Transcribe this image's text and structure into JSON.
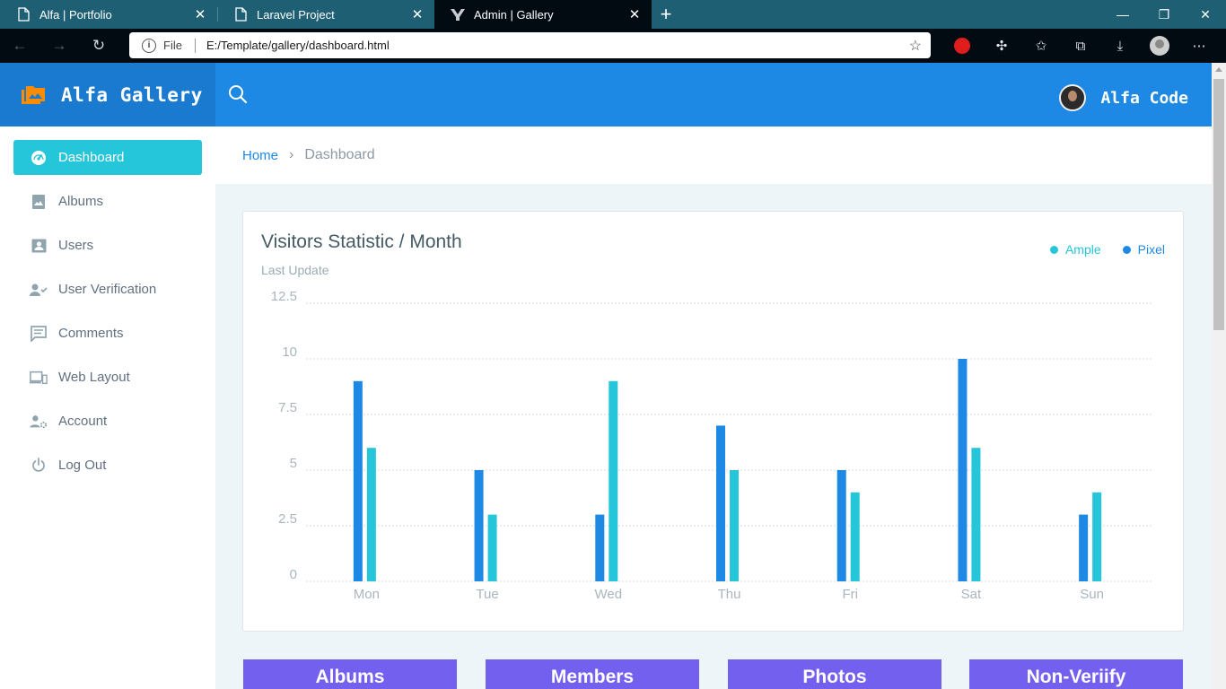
{
  "browser": {
    "tabs": [
      {
        "title": "Alfa | Portfolio",
        "active": false,
        "icon": "page-icon"
      },
      {
        "title": "Laravel Project",
        "active": false,
        "icon": "page-icon"
      },
      {
        "title": "Admin | Gallery",
        "active": true,
        "icon": "site-logo-icon"
      }
    ],
    "address": {
      "scheme": "File",
      "url": "E:/Template/gallery/dashboard.html"
    }
  },
  "app": {
    "brand": "Alfa Gallery",
    "user_name": "Alfa Code"
  },
  "sidebar": {
    "items": [
      {
        "label": "Dashboard",
        "icon": "dashboard-icon",
        "active": true
      },
      {
        "label": "Albums",
        "icon": "album-icon",
        "active": false
      },
      {
        "label": "Users",
        "icon": "user-card-icon",
        "active": false
      },
      {
        "label": "User Verification",
        "icon": "user-check-icon",
        "active": false
      },
      {
        "label": "Comments",
        "icon": "comment-icon",
        "active": false
      },
      {
        "label": "Web Layout",
        "icon": "devices-icon",
        "active": false
      },
      {
        "label": "Account",
        "icon": "account-settings-icon",
        "active": false
      },
      {
        "label": "Log Out",
        "icon": "power-icon",
        "active": false
      }
    ]
  },
  "breadcrumb": {
    "home": "Home",
    "current": "Dashboard"
  },
  "chart_card": {
    "title": "Visitors Statistic / Month",
    "subtitle": "Last Update"
  },
  "chart_data": {
    "type": "bar",
    "categories": [
      "Mon",
      "Tue",
      "Wed",
      "Thu",
      "Fri",
      "Sat",
      "Sun"
    ],
    "series": [
      {
        "name": "Pixel",
        "color": "#1e88e5",
        "values": [
          9,
          5,
          3,
          7,
          5,
          10,
          3
        ]
      },
      {
        "name": "Ample",
        "color": "#26c6da",
        "values": [
          6,
          3,
          9,
          5,
          4,
          6,
          4
        ]
      }
    ],
    "legend_order": [
      "Ample",
      "Pixel"
    ],
    "ylim": [
      0,
      12.5
    ],
    "yticks": [
      0,
      2.5,
      5,
      7.5,
      10,
      12.5
    ],
    "ytick_labels": [
      "0",
      "2.5",
      "5",
      "7.5",
      "10",
      "12.5"
    ],
    "grid": true,
    "legend_position": "top-right"
  },
  "stats": [
    {
      "label": "Albums"
    },
    {
      "label": "Members"
    },
    {
      "label": "Photos"
    },
    {
      "label": "Non-Veriify"
    }
  ],
  "colors": {
    "primary": "#1e88e5",
    "accent": "#26c6da",
    "purple": "#7460ee",
    "logo": "#fb8c00"
  }
}
